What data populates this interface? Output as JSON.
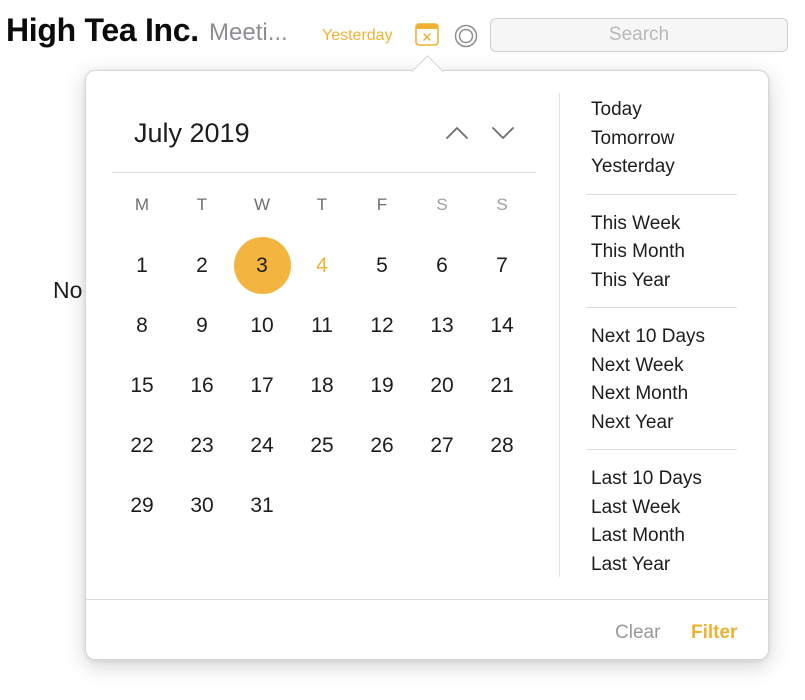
{
  "header": {
    "app_title": "High Tea Inc.",
    "subtitle": "Meeti...",
    "active_filter": "Yesterday",
    "calendar_icon": "calendar-clear-icon",
    "ring_icon": "target-ring-icon",
    "search_placeholder": "Search"
  },
  "background_text": "No",
  "calendar": {
    "month_title": "July 2019",
    "prev_icon": "chevron-up-icon",
    "next_icon": "chevron-down-icon",
    "weekdays": [
      "M",
      "T",
      "W",
      "T",
      "F",
      "S",
      "S"
    ],
    "selected_day": 3,
    "today_day": 4,
    "weeks": [
      [
        "1",
        "2",
        "3",
        "4",
        "5",
        "6",
        "7"
      ],
      [
        "8",
        "9",
        "10",
        "11",
        "12",
        "13",
        "14"
      ],
      [
        "15",
        "16",
        "17",
        "18",
        "19",
        "20",
        "21"
      ],
      [
        "22",
        "23",
        "24",
        "25",
        "26",
        "27",
        "28"
      ],
      [
        "29",
        "30",
        "31"
      ]
    ]
  },
  "quick_ranges": [
    [
      "Today",
      "Tomorrow",
      "Yesterday"
    ],
    [
      "This Week",
      "This Month",
      "This Year"
    ],
    [
      "Next 10 Days",
      "Next Week",
      "Next Month",
      "Next Year"
    ],
    [
      "Last 10 Days",
      "Last Week",
      "Last Month",
      "Last Year"
    ]
  ],
  "footer": {
    "clear_label": "Clear",
    "filter_label": "Filter"
  },
  "colors": {
    "accent": "#f0b232",
    "selected_fill": "#f3b53f",
    "muted": "#9a9a9e"
  }
}
